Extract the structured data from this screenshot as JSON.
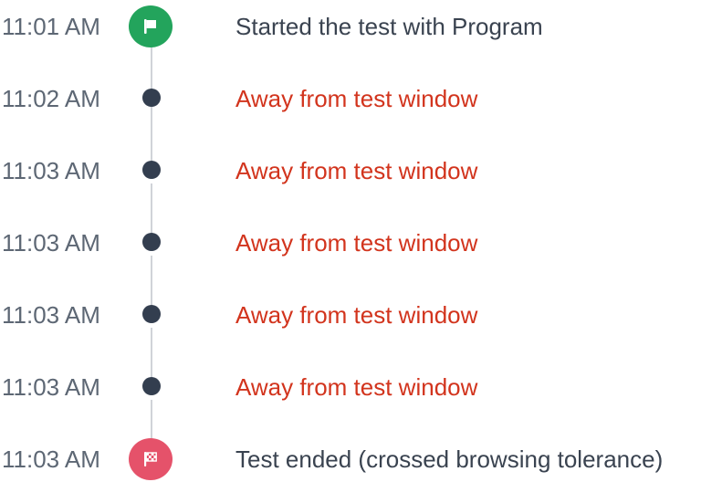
{
  "colors": {
    "time_text": "#5d6774",
    "normal_text": "#3a4350",
    "alert_text": "#d2341d",
    "start_marker": "#23a45c",
    "end_marker": "#e5526a",
    "dot_marker": "#333e4f",
    "connector": "#d0d3d8"
  },
  "events": [
    {
      "time": "11:01 AM",
      "text": "Started the test with Program",
      "marker": "flag-icon",
      "status": "normal"
    },
    {
      "time": "11:02 AM",
      "text": "Away from test window",
      "marker": "dot-icon",
      "status": "alert"
    },
    {
      "time": "11:03 AM",
      "text": "Away from test window",
      "marker": "dot-icon",
      "status": "alert"
    },
    {
      "time": "11:03 AM",
      "text": "Away from test window",
      "marker": "dot-icon",
      "status": "alert"
    },
    {
      "time": "11:03 AM",
      "text": "Away from test window",
      "marker": "dot-icon",
      "status": "alert"
    },
    {
      "time": "11:03 AM",
      "text": "Away from test window",
      "marker": "dot-icon",
      "status": "alert"
    },
    {
      "time": "11:03 AM",
      "text": "Test ended (crossed browsing tolerance)",
      "marker": "checkered-flag-icon",
      "status": "normal"
    }
  ]
}
